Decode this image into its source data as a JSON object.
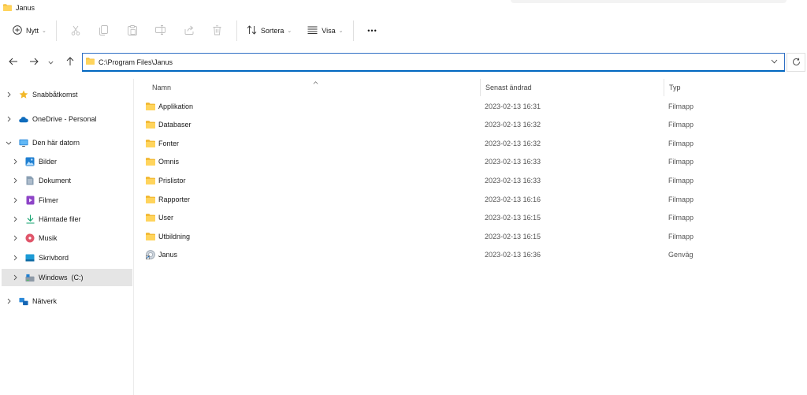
{
  "window": {
    "title": "Janus"
  },
  "toolbar": {
    "new_label": "Nytt",
    "sort_label": "Sortera",
    "view_label": "Visa",
    "more_label": "•••"
  },
  "address": {
    "path": "C:\\Program Files\\Janus"
  },
  "sidebar": {
    "items": [
      {
        "label": "Snabbåtkomst",
        "icon": "star-icon"
      },
      {
        "label": "OneDrive - Personal",
        "icon": "cloud-icon"
      },
      {
        "label": "Den här datorn",
        "icon": "computer-icon"
      },
      {
        "label": "Bilder",
        "icon": "pictures-icon"
      },
      {
        "label": "Dokument",
        "icon": "documents-icon"
      },
      {
        "label": "Filmer",
        "icon": "videos-icon"
      },
      {
        "label": "Hämtade filer",
        "icon": "downloads-icon"
      },
      {
        "label": "Musik",
        "icon": "music-icon"
      },
      {
        "label": "Skrivbord",
        "icon": "desktop-icon"
      },
      {
        "label": "Windows  (C:)",
        "icon": "drive-icon"
      },
      {
        "label": "Nätverk",
        "icon": "network-icon"
      }
    ]
  },
  "columns": {
    "name": "Namn",
    "modified": "Senast ändrad",
    "type": "Typ"
  },
  "files": [
    {
      "name": "Applikation",
      "modified": "2023-02-13 16:31",
      "type": "Filmapp",
      "icon": "folder-icon"
    },
    {
      "name": "Databaser",
      "modified": "2023-02-13 16:32",
      "type": "Filmapp",
      "icon": "folder-icon"
    },
    {
      "name": "Fonter",
      "modified": "2023-02-13 16:32",
      "type": "Filmapp",
      "icon": "folder-icon"
    },
    {
      "name": "Omnis",
      "modified": "2023-02-13 16:33",
      "type": "Filmapp",
      "icon": "folder-icon"
    },
    {
      "name": "Prislistor",
      "modified": "2023-02-13 16:33",
      "type": "Filmapp",
      "icon": "folder-icon"
    },
    {
      "name": "Rapporter",
      "modified": "2023-02-13 16:16",
      "type": "Filmapp",
      "icon": "folder-icon"
    },
    {
      "name": "User",
      "modified": "2023-02-13 16:15",
      "type": "Filmapp",
      "icon": "folder-icon"
    },
    {
      "name": "Utbildning",
      "modified": "2023-02-13 16:15",
      "type": "Filmapp",
      "icon": "folder-icon"
    },
    {
      "name": "Janus",
      "modified": "2023-02-13 16:36",
      "type": "Genväg",
      "icon": "shortcut-icon"
    }
  ],
  "colors": {
    "folder": "#f4c142",
    "accent": "#0067c0",
    "selection": "#e5e5e5"
  }
}
